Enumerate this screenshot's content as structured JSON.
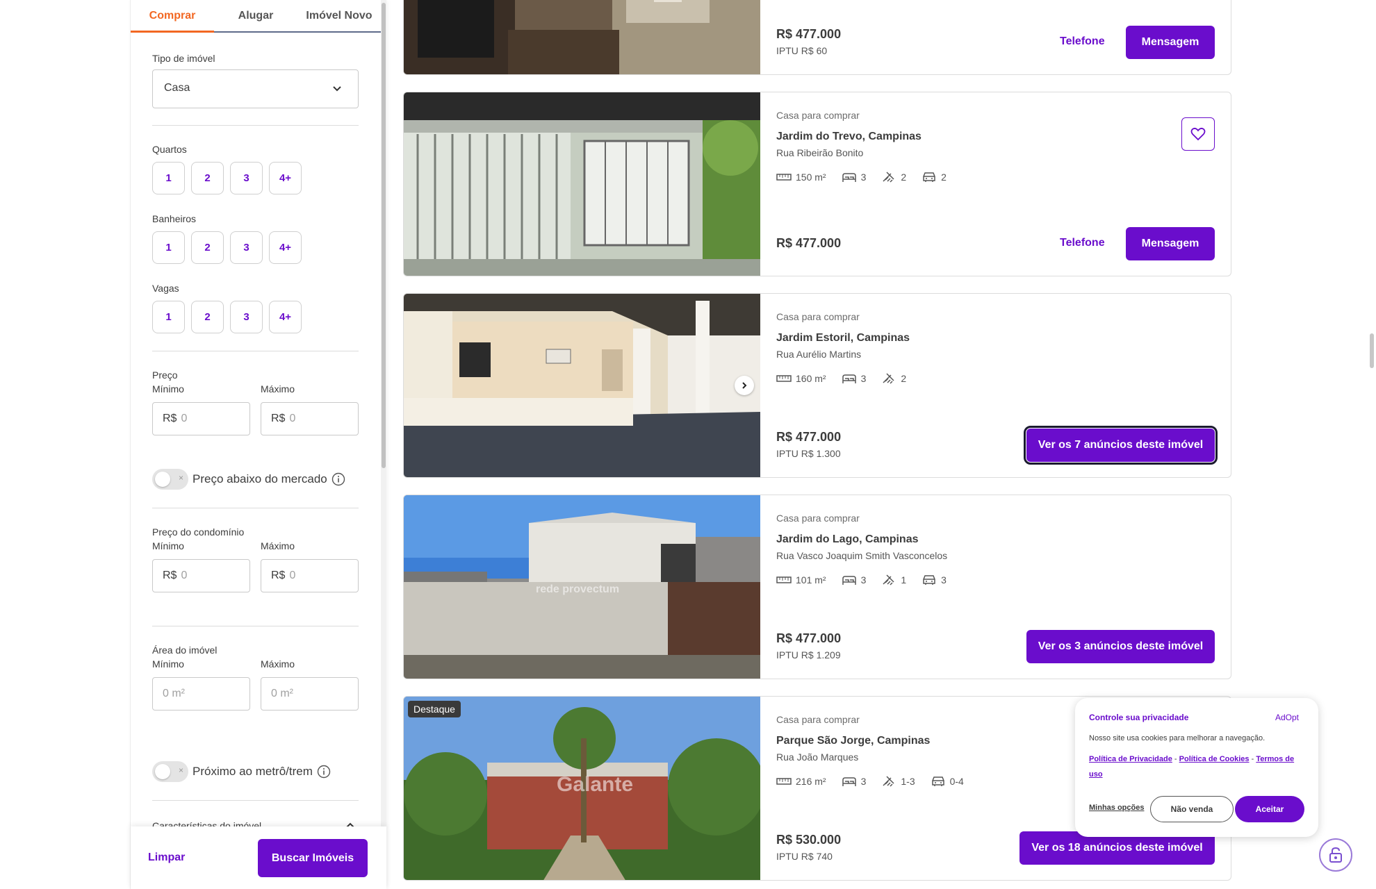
{
  "sidebar": {
    "tabs": [
      {
        "label": "Comprar",
        "active": true
      },
      {
        "label": "Alugar",
        "active": false
      },
      {
        "label": "Imóvel Novo",
        "active": false
      }
    ],
    "property_type": {
      "label": "Tipo de imóvel",
      "value": "Casa"
    },
    "bedrooms": {
      "label": "Quartos",
      "options": [
        "1",
        "2",
        "3",
        "4+"
      ]
    },
    "bathrooms": {
      "label": "Banheiros",
      "options": [
        "1",
        "2",
        "3",
        "4+"
      ]
    },
    "parking": {
      "label": "Vagas",
      "options": [
        "1",
        "2",
        "3",
        "4+"
      ]
    },
    "price": {
      "label": "Preço",
      "min_label": "Mínimo",
      "max_label": "Máximo",
      "currency": "R$",
      "min_placeholder": "0",
      "max_placeholder": "0"
    },
    "below_market": {
      "label": "Preço abaixo do mercado",
      "enabled": false
    },
    "condo_price": {
      "label": "Preço do condomínio",
      "min_label": "Mínimo",
      "max_label": "Máximo",
      "currency": "R$",
      "min_placeholder": "0",
      "max_placeholder": "0"
    },
    "area": {
      "label": "Área do imóvel",
      "min_label": "Mínimo",
      "max_label": "Máximo",
      "min_placeholder": "0 m²",
      "max_placeholder": "0 m²"
    },
    "near_metro": {
      "label": "Próximo ao metrô/trem",
      "enabled": false
    },
    "features_section": {
      "label": "Características do imóvel"
    },
    "clear_label": "Limpar",
    "search_label": "Buscar Imóveis"
  },
  "listings": [
    {
      "price": "R$ 477.000",
      "iptu": "IPTU R$ 60",
      "phone_label": "Telefone",
      "message_label": "Mensagem"
    },
    {
      "type": "Casa para comprar",
      "title": "Jardim do Trevo, Campinas",
      "street": "Rua Ribeirão Bonito",
      "area": "150 m²",
      "bedrooms": "3",
      "bathrooms": "2",
      "parking": "2",
      "price": "R$ 477.000",
      "phone_label": "Telefone",
      "message_label": "Mensagem"
    },
    {
      "type": "Casa para comprar",
      "title": "Jardim Estoril, Campinas",
      "street": "Rua Aurélio Martins",
      "area": "160 m²",
      "bedrooms": "3",
      "bathrooms": "2",
      "price": "R$ 477.000",
      "iptu": "IPTU R$ 1.300",
      "cta_label": "Ver os 7 anúncios deste imóvel"
    },
    {
      "type": "Casa para comprar",
      "title": "Jardim do Lago, Campinas",
      "street": "Rua Vasco Joaquim Smith Vasconcelos",
      "area": "101 m²",
      "bedrooms": "3",
      "bathrooms": "1",
      "parking": "3",
      "price": "R$ 477.000",
      "iptu": "IPTU R$ 1.209",
      "cta_label": "Ver os 3 anúncios deste imóvel",
      "watermark": "rede provectum"
    },
    {
      "badge": "Destaque",
      "type": "Casa para comprar",
      "title": "Parque São Jorge, Campinas",
      "street": "Rua João Marques",
      "area": "216 m²",
      "bedrooms": "3",
      "bathrooms": "1-3",
      "parking": "0-4",
      "price": "R$ 530.000",
      "iptu": "IPTU R$ 740",
      "cta_label": "Ver os 18 anúncios deste imóvel",
      "watermark": "Galante"
    }
  ],
  "cookie_banner": {
    "title": "Controle sua privacidade",
    "brand": "AdOpt",
    "description": "Nosso site usa cookies para melhorar a navegação.",
    "privacy_policy": "Política de Privacidade",
    "cookie_policy": "Política de Cookies",
    "terms": "Termos de uso",
    "separator": "-",
    "options_label": "Minhas opções",
    "reject_label": "Não venda",
    "accept_label": "Aceitar"
  },
  "colors": {
    "accent": "#6a0dcc",
    "active_tab": "#f26722"
  }
}
